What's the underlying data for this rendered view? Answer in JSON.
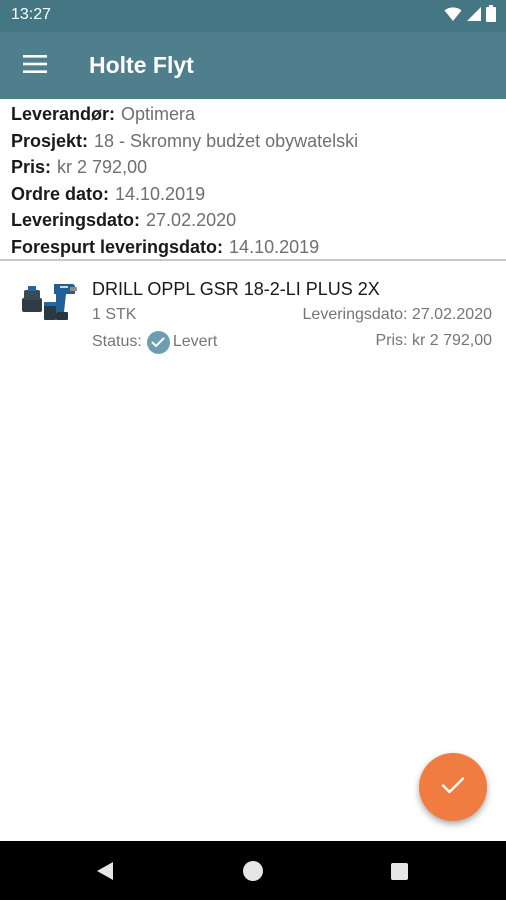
{
  "status_bar": {
    "time": "13:27",
    "icons": [
      "wifi-icon",
      "signal-icon",
      "battery-icon"
    ]
  },
  "app_bar": {
    "menu_icon": "hamburger-menu-icon",
    "title": "Holte Flyt"
  },
  "order": {
    "fields": [
      {
        "label": "Leverandør:",
        "value": "Optimera"
      },
      {
        "label": "Prosjekt:",
        "value": "18 - Skromny budżet obywatelski"
      },
      {
        "label": "Pris:",
        "value": "kr 2 792,00"
      },
      {
        "label": "Ordre dato:",
        "value": "14.10.2019"
      },
      {
        "label": "Leveringsdato:",
        "value": "27.02.2020"
      },
      {
        "label": "Forespurt leveringsdato:",
        "value": "14.10.2019"
      }
    ]
  },
  "order_lines": [
    {
      "image_icon": "drill-product-image",
      "name": "DRILL OPPL GSR 18-2-LI PLUS 2X",
      "quantity": "1 STK",
      "delivery_date": "Leveringsdato: 27.02.2020",
      "status_label": "Status:",
      "status_icon": "check-circle-icon",
      "status_value": "Levert",
      "price": "Pris: kr 2 792,00"
    }
  ],
  "fab": {
    "icon": "checkmark-icon"
  },
  "nav_bar": {
    "icons": [
      "back-icon",
      "home-icon",
      "recents-icon"
    ]
  },
  "colors": {
    "status_bar": "#447683",
    "app_bar": "#4f7f8d",
    "fab": "#f07c42",
    "status_check": "#6d9db0"
  }
}
